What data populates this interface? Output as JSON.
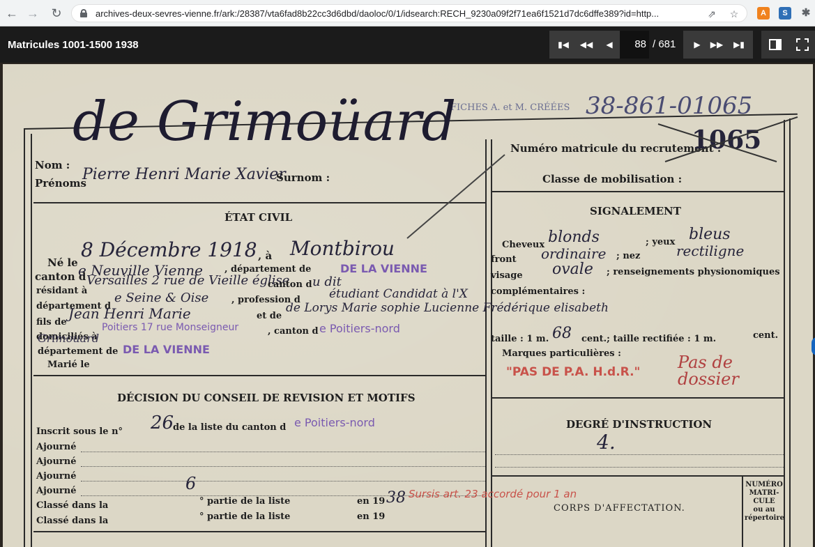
{
  "browser": {
    "url": "archives-deux-sevres-vienne.fr/ark:/28387/vta6fad8b22cc3d6dbd/daoloc/0/1/idsearch:RECH_9230a09f2f71ea6f1521d7dc6dffe389?id=http...",
    "back_icon": "arrow-left-icon",
    "forward_icon": "arrow-right-icon",
    "reload_icon": "reload-icon",
    "share_icon": "share-icon",
    "bookmark_icon": "star-icon",
    "extensions": [
      "A",
      "S",
      "✱"
    ],
    "ext_colors": [
      "#f0821e",
      "#2f6fb6",
      "#5f6368"
    ]
  },
  "viewer": {
    "title": "Matricules 1001-1500 1938",
    "page_current": "88",
    "page_total": "/ 681",
    "buttons": [
      "⏮",
      "⏪",
      "◀",
      "▶",
      "⏩",
      "⏭"
    ],
    "layout_icon": "split-view-icon",
    "fullscreen_icon": "fullscreen-icon"
  },
  "document": {
    "header": {
      "fiches_label": "FICHES A. et M. CRÉÉES",
      "fiches_number": "38-861-01065",
      "surname": "de Grimoüard",
      "nom_label": "Nom :",
      "prenoms_label": "Prénoms",
      "prenoms_value": "Pierre Henri Marie Xavier",
      "surnom_label": "Surnom :",
      "matricule_label": "Numéro matricule du recrutement :",
      "matricule_value": "1065",
      "classe_label": "Classe de mobilisation :"
    },
    "etat_civil": {
      "heading": "ÉTAT CIVIL",
      "ne_label": "Né le",
      "ne_value": "8 Décembre 1918",
      "a_label": ", à",
      "lieu": "Montbirou",
      "canton_label": "canton d",
      "canton_value": "e Neuville Vienne",
      "departement_label": ", département de",
      "departement_stamp": "DE LA VIENNE",
      "residant_label": "résidant à",
      "residant_value": "Versailles 2 rue de Vieille église",
      "canton2_label": "canton d",
      "canton2_value": "u dit",
      "departement2_label": "département d",
      "departement2_value": "e Seine & Oise",
      "profession_label": ", profession d",
      "profession_value": "étudiant Candidat à l'X",
      "fils_label": "fils de",
      "fils_value": "Jean Henri Marie",
      "et_label": "et de",
      "mere_value": "de Lorys Marie sophie Lucienne Frédérique elisabeth",
      "domicilies_label": "domiciliés à",
      "domicilies_value": "Poitiers 17 rue Monseigneur",
      "canton3_label": ", canton d",
      "canton3_stamp": "e Poitiers-nord",
      "grimouard": "Grimouard",
      "departement3_label": "département de",
      "departement3_stamp": "DE LA VIENNE",
      "marie_label": "Marié le"
    },
    "signalement": {
      "heading": "SIGNALEMENT",
      "cheveux_label": "Cheveux",
      "cheveux_value": "blonds",
      "yeux_label": "; yeux",
      "yeux_value": "bleus",
      "front_label": "front",
      "front_value": "ordinaire",
      "nez_label": "; nez",
      "nez_value": "rectiligne",
      "visage_label": "visage",
      "visage_value": "ovale",
      "renseignements": "; renseignements physionomiques",
      "complementaires": "complémentaires :",
      "taille_label": "taille : 1 m.",
      "taille_value": "68",
      "taille_rest": "cent.; taille rectifiée : 1 m.",
      "taille_cent": "cent.",
      "marques_label": "Marques particulières :",
      "pas_stamp": "\"PAS DE P.A. H.d.R.\"",
      "pas_de_dossier": "Pas de dossier"
    },
    "decision": {
      "heading": "DÉCISION DU CONSEIL DE REVISION ET MOTIFS",
      "inscrit_label": "Inscrit sous le n°",
      "inscrit_value": "26",
      "liste_label": "de la liste du canton d",
      "liste_stamp": "e Poitiers-nord",
      "ajourne": [
        "Ajourné",
        "Ajourné",
        "Ajourné",
        "Ajourné"
      ],
      "classe1_label": "Classé dans la",
      "classe1_value": "6",
      "partie_label": "° partie de la liste",
      "en_label": "en 19",
      "en_value": "38",
      "sursis_stamp": "Sursis art. 23 accordé pour 1 an",
      "classe2_label": "Classé dans la",
      "partie2_label": "° partie de la liste",
      "en2_label": "en 19"
    },
    "instruction": {
      "heading": "DEGRÉ D'INSTRUCTION",
      "value": "4."
    },
    "affectation": {
      "corps_label": "CORPS D'AFFECTATION.",
      "numero_lines": [
        "NUMÉRO",
        "MATRI-",
        "CULE",
        "ou au",
        "répertoire"
      ]
    }
  }
}
